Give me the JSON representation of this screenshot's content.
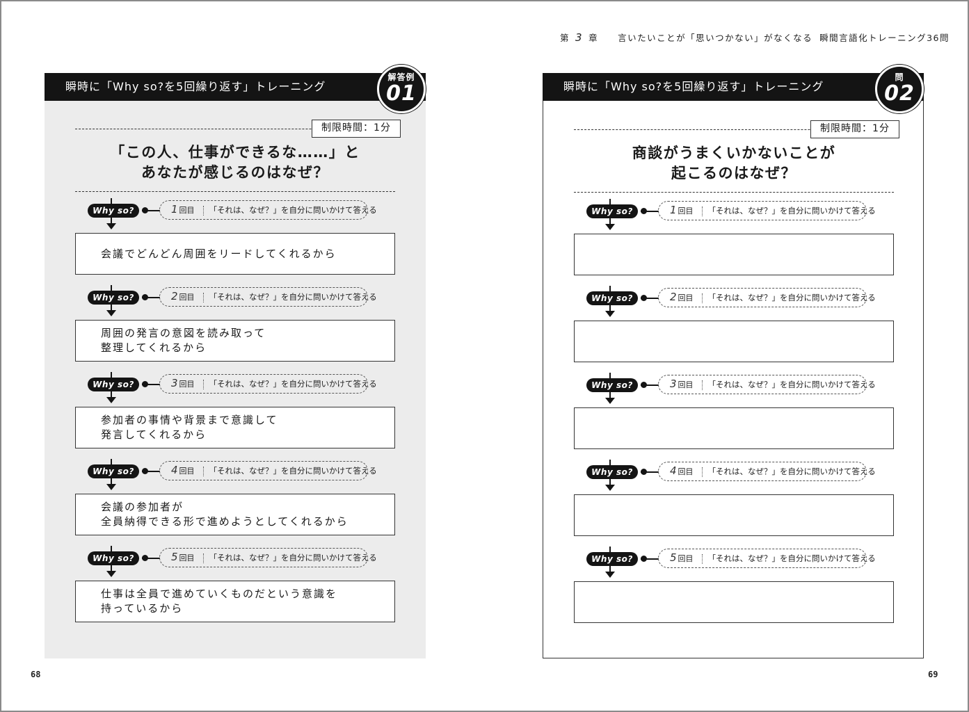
{
  "header": {
    "chapter_prefix": "第",
    "chapter_number": "3",
    "chapter_suffix": "章",
    "chapter_title": "言いたいことが「思いつかない」がなくなる",
    "book_section": "瞬間言語化トレーニング36問"
  },
  "page_numbers": {
    "left": "68",
    "right": "69"
  },
  "left_page": {
    "title": "瞬時に「Why so?を5回繰り返す」トレーニング",
    "badge_label": "解答例",
    "badge_number": "01",
    "time_limit": "制限時間：1分",
    "question_line1": "「この人、仕事ができるな……」と",
    "question_line2": "あなたが感じるのはなぜ？",
    "steps": [
      {
        "why": "Why so?",
        "num": "1",
        "unit": "回目",
        "instruction": "「それは、なぜ？」を自分に問いかけて答える",
        "answer": "会議でどんどん周囲をリードしてくれるから"
      },
      {
        "why": "Why so?",
        "num": "2",
        "unit": "回目",
        "instruction": "「それは、なぜ？」を自分に問いかけて答える",
        "answer": "周囲の発言の意図を読み取って\n整理してくれるから"
      },
      {
        "why": "Why so?",
        "num": "3",
        "unit": "回目",
        "instruction": "「それは、なぜ？」を自分に問いかけて答える",
        "answer": "参加者の事情や背景まで意識して\n発言してくれるから"
      },
      {
        "why": "Why so?",
        "num": "4",
        "unit": "回目",
        "instruction": "「それは、なぜ？」を自分に問いかけて答える",
        "answer": "会議の参加者が\n全員納得できる形で進めようとしてくれるから"
      },
      {
        "why": "Why so?",
        "num": "5",
        "unit": "回目",
        "instruction": "「それは、なぜ？」を自分に問いかけて答える",
        "answer": "仕事は全員で進めていくものだという意識を\n持っているから"
      }
    ]
  },
  "right_page": {
    "title": "瞬時に「Why so?を5回繰り返す」トレーニング",
    "badge_label": "問",
    "badge_number": "02",
    "time_limit": "制限時間：1分",
    "question_line1": "商談がうまくいかないことが",
    "question_line2": "起こるのはなぜ？",
    "steps": [
      {
        "why": "Why so?",
        "num": "1",
        "unit": "回目",
        "instruction": "「それは、なぜ？」を自分に問いかけて答える",
        "answer": ""
      },
      {
        "why": "Why so?",
        "num": "2",
        "unit": "回目",
        "instruction": "「それは、なぜ？」を自分に問いかけて答える",
        "answer": ""
      },
      {
        "why": "Why so?",
        "num": "3",
        "unit": "回目",
        "instruction": "「それは、なぜ？」を自分に問いかけて答える",
        "answer": ""
      },
      {
        "why": "Why so?",
        "num": "4",
        "unit": "回目",
        "instruction": "「それは、なぜ？」を自分に問いかけて答える",
        "answer": ""
      },
      {
        "why": "Why so?",
        "num": "5",
        "unit": "回目",
        "instruction": "「それは、なぜ？」を自分に問いかけて答える",
        "answer": ""
      }
    ]
  }
}
